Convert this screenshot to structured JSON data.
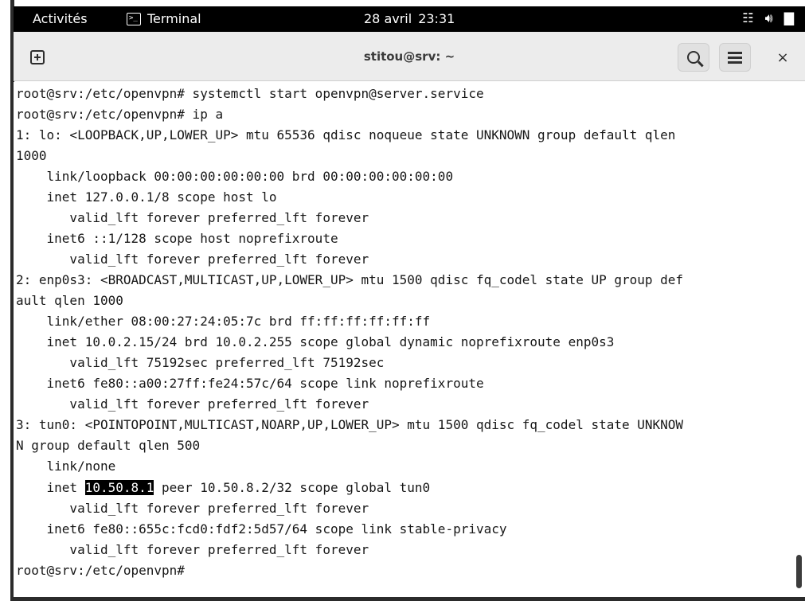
{
  "topbar": {
    "activities": "Activités",
    "app_name": "Terminal",
    "app_icon": "terminal-icon",
    "date": "28 avril",
    "time": "23:31",
    "tray_icons": [
      "network-icon",
      "volume-icon",
      "battery-icon"
    ]
  },
  "window": {
    "title": "stitou@srv: ~",
    "buttons": {
      "new_tab": "new-tab-icon",
      "search": "search-icon",
      "menu": "hamburger-menu-icon",
      "close": "×"
    }
  },
  "terminal": {
    "lines": [
      "root@srv:/etc/openvpn# systemctl start openvpn@server.service",
      "root@srv:/etc/openvpn# ip a",
      "1: lo: <LOOPBACK,UP,LOWER_UP> mtu 65536 qdisc noqueue state UNKNOWN group default qlen",
      "1000",
      "    link/loopback 00:00:00:00:00:00 brd 00:00:00:00:00:00",
      "    inet 127.0.0.1/8 scope host lo",
      "       valid_lft forever preferred_lft forever",
      "    inet6 ::1/128 scope host noprefixroute",
      "       valid_lft forever preferred_lft forever",
      "2: enp0s3: <BROADCAST,MULTICAST,UP,LOWER_UP> mtu 1500 qdisc fq_codel state UP group def",
      "ault qlen 1000",
      "    link/ether 08:00:27:24:05:7c brd ff:ff:ff:ff:ff:ff",
      "    inet 10.0.2.15/24 brd 10.0.2.255 scope global dynamic noprefixroute enp0s3",
      "       valid_lft 75192sec preferred_lft 75192sec",
      "    inet6 fe80::a00:27ff:fe24:57c/64 scope link noprefixroute",
      "       valid_lft forever preferred_lft forever",
      "3: tun0: <POINTOPOINT,MULTICAST,NOARP,UP,LOWER_UP> mtu 1500 qdisc fq_codel state UNKNOW",
      "N group default qlen 500",
      "    link/none",
      "    inet ",
      "       valid_lft forever preferred_lft forever",
      "    inet6 fe80::655c:fcd0:fdf2:5d57/64 scope link stable-privacy",
      "       valid_lft forever preferred_lft forever",
      "root@srv:/etc/openvpn# "
    ],
    "highlighted_ip": "10.50.8.1",
    "after_highlight": " peer 10.50.8.2/32 scope global tun0"
  }
}
